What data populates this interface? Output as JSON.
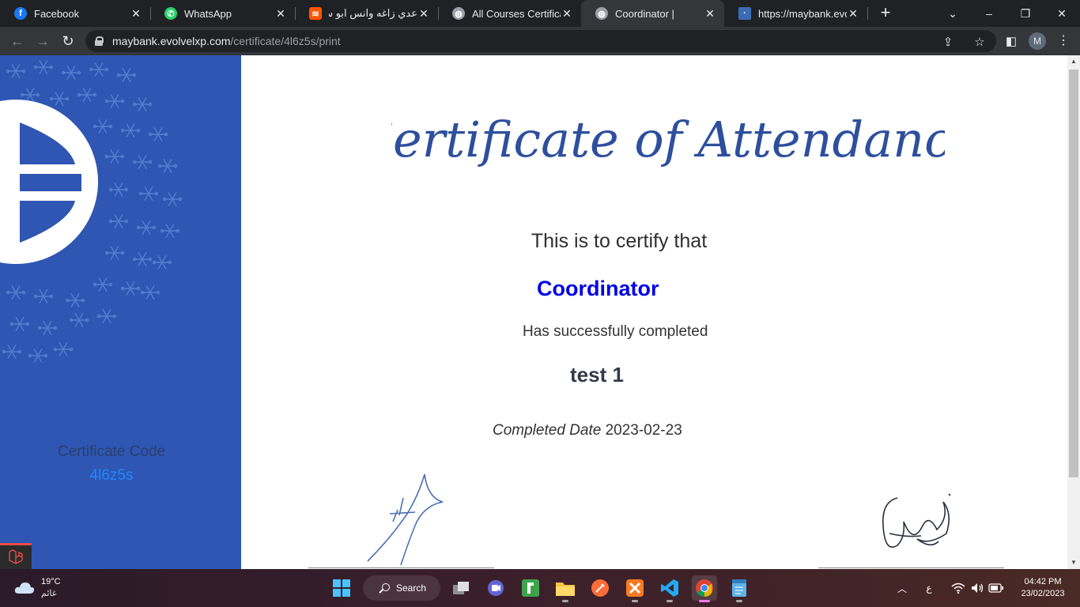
{
  "browser": {
    "tabs": [
      {
        "title": "Facebook",
        "favicon": "facebook-icon",
        "color": "#1877f2",
        "active": false
      },
      {
        "title": "WhatsApp",
        "favicon": "whatsapp-icon",
        "color": "#25d366",
        "active": false
      },
      {
        "title": "عدي زاغه وانس ابو سنينة",
        "favicon": "soundcloud-icon",
        "color": "#ff5500",
        "active": false
      },
      {
        "title": "All Courses Certificate",
        "favicon": "globe-icon",
        "color": "#9aa0a6",
        "active": false
      },
      {
        "title": "Coordinator |",
        "favicon": "globe-icon",
        "color": "#9aa0a6",
        "active": true
      },
      {
        "title": "https://maybank.evolve",
        "favicon": "page-icon",
        "color": "#3b6bb5",
        "active": false
      }
    ],
    "url_host": "maybank.evolvelxp.com",
    "url_path": "/certificate/4l6z5s/print",
    "profile_initial": "M"
  },
  "certificate": {
    "title": "Certificate of Attendance",
    "certify_text": "This is to certify that",
    "recipient": "Coordinator",
    "completed_text": "Has successfully completed",
    "course": "test 1",
    "date_label": "Completed Date",
    "date_value": "2023-02-23",
    "code_label": "Certificate Code",
    "code_value": "4l6z5s"
  },
  "taskbar": {
    "weather_temp": "19°C",
    "weather_condition": "غائم",
    "search_label": "Search",
    "language_indicator": "ع",
    "time": "04:42 PM",
    "date": "23/02/2023"
  },
  "colors": {
    "side_panel": "#2e56b2",
    "recipient": "#0000e6",
    "code_value": "#1e88ff",
    "title_script": "#2d4f9e"
  }
}
